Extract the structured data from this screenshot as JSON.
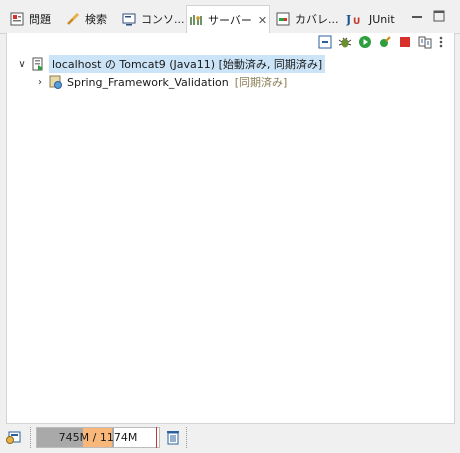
{
  "tabs": [
    {
      "label": "問題",
      "icon": "problems-icon"
    },
    {
      "label": "検索",
      "icon": "search-icon"
    },
    {
      "label": "コンソ...",
      "icon": "console-icon"
    },
    {
      "label": "サーバー",
      "icon": "servers-icon",
      "active": true
    },
    {
      "label": "カバレ...",
      "icon": "coverage-icon"
    },
    {
      "label": "JUnit",
      "icon": "junit-icon"
    }
  ],
  "tree": {
    "server": {
      "label": "localhost の Tomcat9 (Java11)",
      "state": "[始動済み, 同期済み]"
    },
    "module": {
      "label": "Spring_Framework_Validation",
      "state": "[同期済み]"
    }
  },
  "status": {
    "heap_text": "745M / 1174M",
    "heap_used_fraction": 0.634,
    "heap_committed_fraction": 0.62
  },
  "colors": {
    "selection": "#cce4f7",
    "start_green": "#2e9e3f",
    "stop_red": "#d9302c"
  }
}
